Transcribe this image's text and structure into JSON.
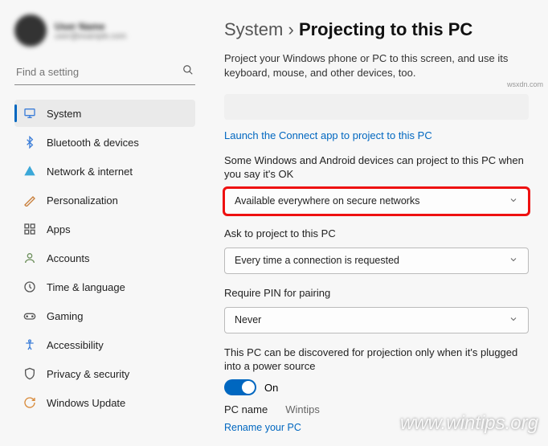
{
  "profile": {
    "name": "User Name",
    "email": "user@example.com"
  },
  "search": {
    "placeholder": "Find a setting"
  },
  "sidebar": {
    "items": [
      {
        "label": "System"
      },
      {
        "label": "Bluetooth & devices"
      },
      {
        "label": "Network & internet"
      },
      {
        "label": "Personalization"
      },
      {
        "label": "Apps"
      },
      {
        "label": "Accounts"
      },
      {
        "label": "Time & language"
      },
      {
        "label": "Gaming"
      },
      {
        "label": "Accessibility"
      },
      {
        "label": "Privacy & security"
      },
      {
        "label": "Windows Update"
      }
    ]
  },
  "breadcrumb": {
    "parent": "System",
    "separator": "›",
    "current": "Projecting to this PC"
  },
  "main": {
    "description": "Project your Windows phone or PC to this screen, and use its keyboard, mouse, and other devices, too.",
    "launch_link": "Launch the Connect app to project to this PC",
    "availability": {
      "label": "Some Windows and Android devices can project to this PC when you say it's OK",
      "value": "Available everywhere on secure networks"
    },
    "ask": {
      "label": "Ask to project to this PC",
      "value": "Every time a connection is requested"
    },
    "pin": {
      "label": "Require PIN for pairing",
      "value": "Never"
    },
    "discovery": {
      "label": "This PC can be discovered for projection only when it's plugged into a power source",
      "toggle_state": "On"
    },
    "pc_name": {
      "label": "PC name",
      "value": "Wintips"
    },
    "rename_link": "Rename your PC"
  },
  "watermark": "www.wintips.org",
  "attribution": "wsxdn.com"
}
